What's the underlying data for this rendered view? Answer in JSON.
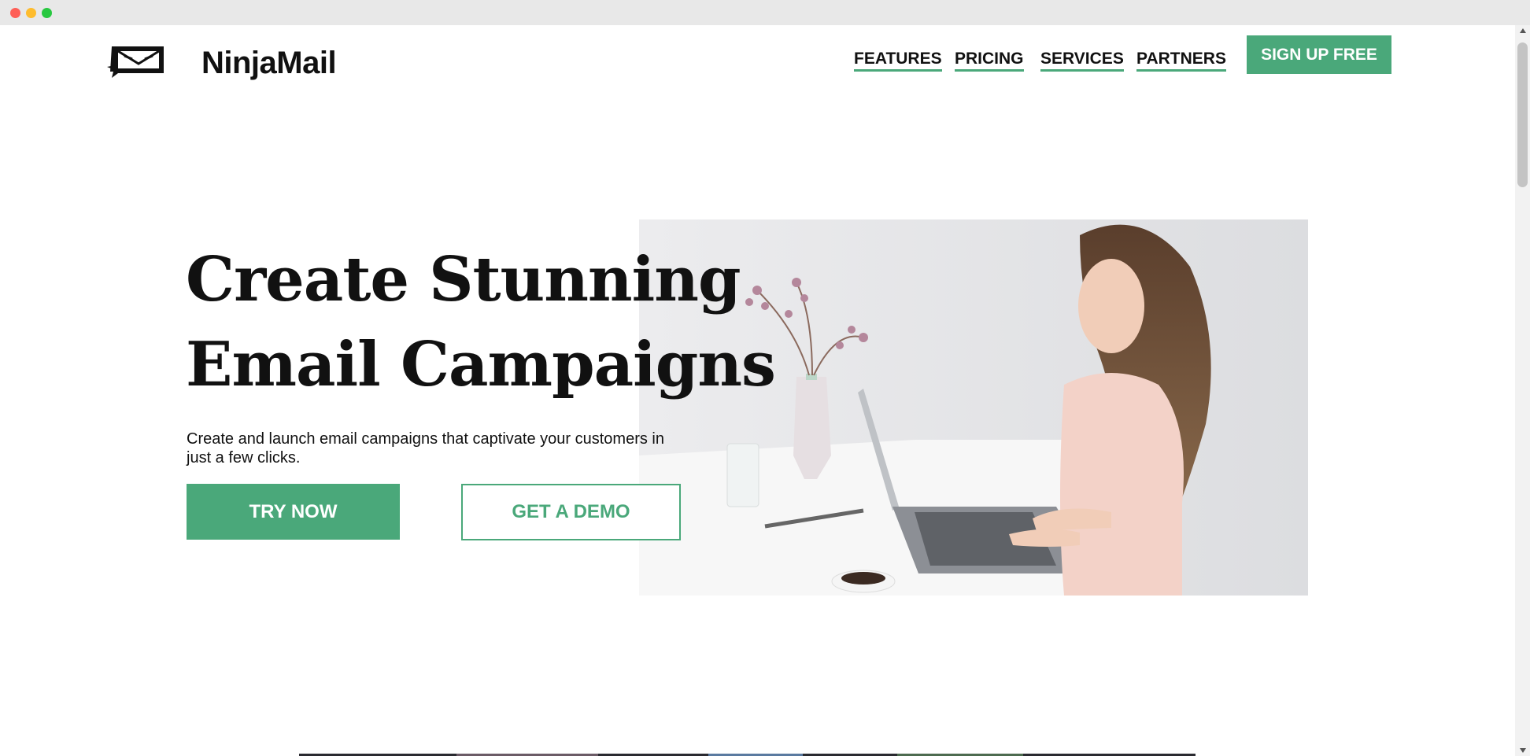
{
  "window": {
    "controls": [
      "close",
      "minimize",
      "maximize"
    ]
  },
  "header": {
    "logo_icon": "ninja-envelope-icon",
    "brand": "NinjaMail",
    "nav": [
      {
        "label": "FEATURES"
      },
      {
        "label": "PRICING"
      },
      {
        "label": "SERVICES"
      },
      {
        "label": "PARTNERS"
      }
    ],
    "signup_label": "SIGN UP FREE"
  },
  "hero": {
    "title_line1": "Create Stunning",
    "title_line2": "Email Campaigns",
    "subtitle": "Create and launch email campaigns that captivate your customers in just a few clicks.",
    "try_label": "TRY NOW",
    "demo_label": "GET A DEMO"
  },
  "colors": {
    "accent": "#4aa87a",
    "text": "#111111",
    "background": "#ffffff"
  }
}
